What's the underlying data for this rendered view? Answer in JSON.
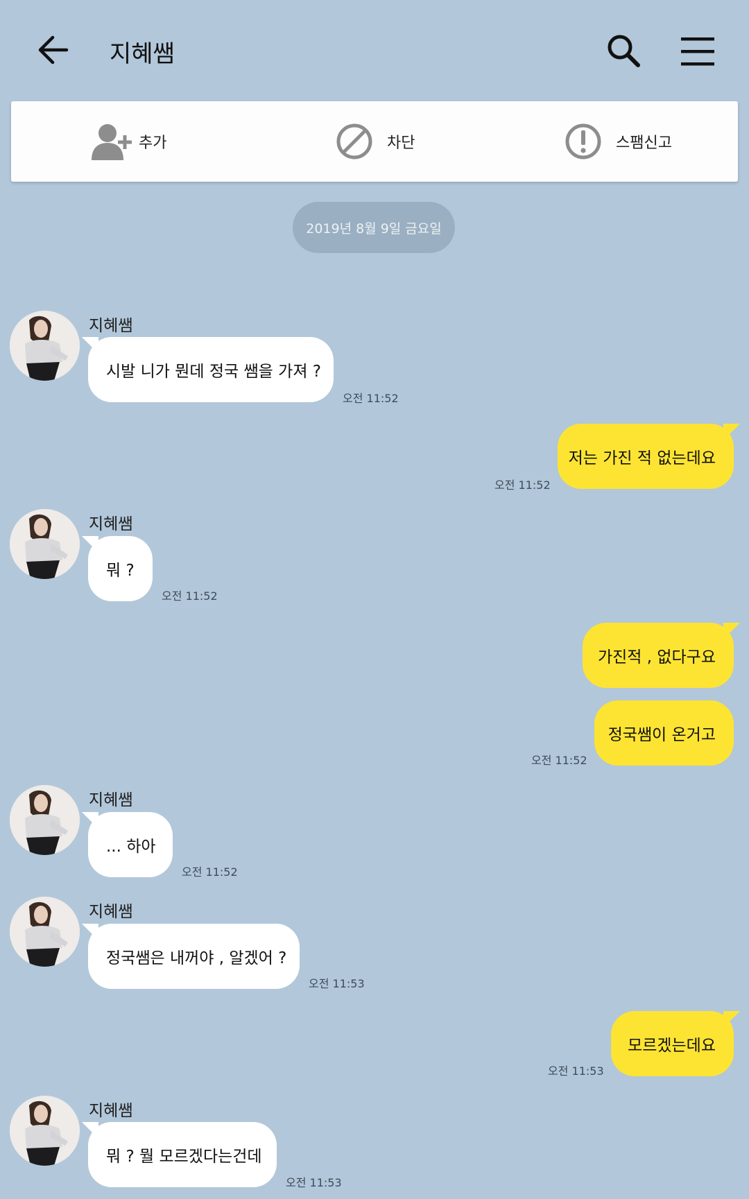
{
  "header": {
    "title": "지혜쌤",
    "back_icon": "arrow-left-icon",
    "search_icon": "search-icon",
    "menu_icon": "hamburger-menu-icon"
  },
  "actions": {
    "add": "추가",
    "block": "차단",
    "report_spam": "스팸신고"
  },
  "date_divider": "2019년 8월 9일 금요일",
  "colors": {
    "background": "#b2c7da",
    "incoming_bubble": "#ffffff",
    "outgoing_bubble": "#fde433"
  },
  "messages": [
    {
      "direction": "in",
      "sender": "지혜쌤",
      "text": "시발 니가 뭔데 정국 쌤을 가져 ?",
      "time": "오전 11:52"
    },
    {
      "direction": "out",
      "text": "저는 가진 적 없는데요",
      "time": "오전 11:52"
    },
    {
      "direction": "in",
      "sender": "지혜쌤",
      "text": "뭐 ?",
      "time": "오전 11:52"
    },
    {
      "direction": "out",
      "text": "가진적 , 없다구요"
    },
    {
      "direction": "out",
      "text": "정국쌤이 온거고",
      "time": "오전 11:52"
    },
    {
      "direction": "in",
      "sender": "지혜쌤",
      "text": "... 하아",
      "time": "오전 11:52"
    },
    {
      "direction": "in",
      "sender": "지혜쌤",
      "text": "정국쌤은 내꺼야 , 알겠어 ?",
      "time": "오전 11:53"
    },
    {
      "direction": "out",
      "text": "모르겠는데요",
      "time": "오전 11:53"
    },
    {
      "direction": "in",
      "sender": "지혜쌤",
      "text": "뭐 ? 뭘 모르겠다는건데",
      "time": "오전 11:53"
    }
  ]
}
